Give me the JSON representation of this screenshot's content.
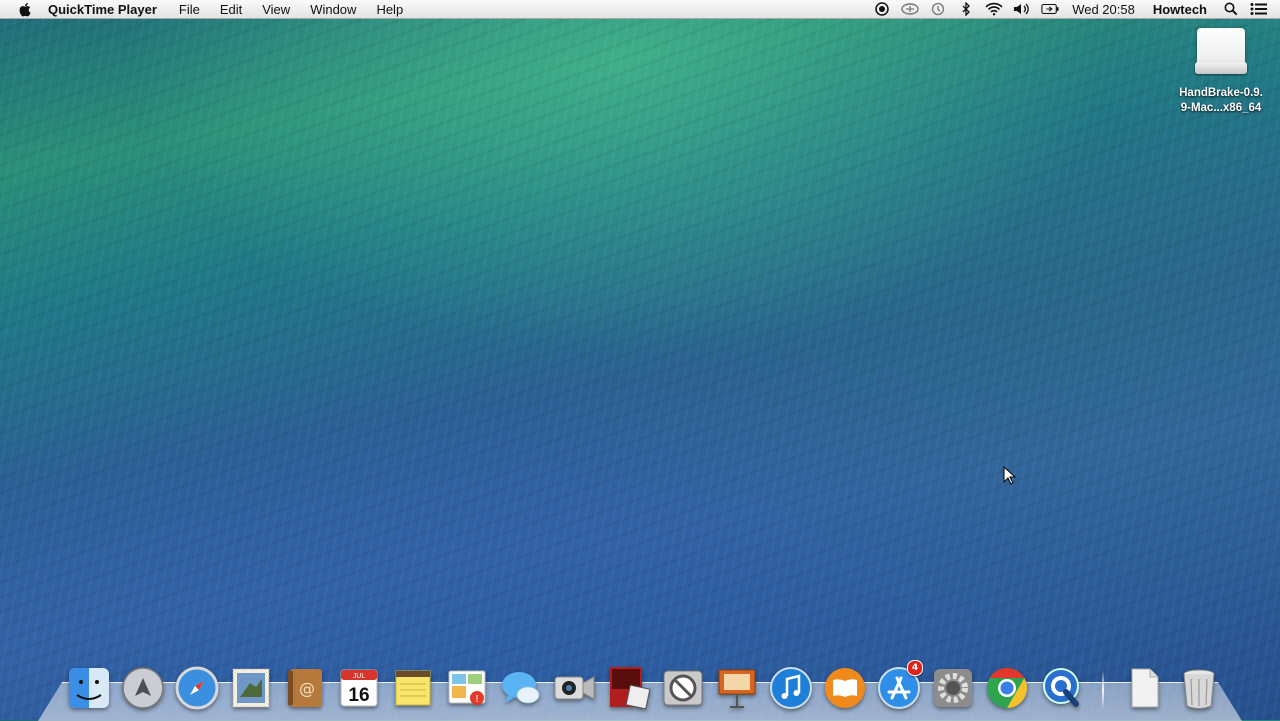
{
  "menubar": {
    "app_name": "QuickTime Player",
    "menus": [
      "File",
      "Edit",
      "View",
      "Window",
      "Help"
    ],
    "clock": "Wed 20:58",
    "user": "Howtech",
    "status_icons": [
      "screen-record-icon",
      "sync-icon",
      "time-machine-icon",
      "bluetooth-icon",
      "wifi-icon",
      "volume-icon",
      "battery-icon",
      "search-icon",
      "notification-center-icon"
    ]
  },
  "desktop": {
    "icons": [
      {
        "label_line1": "HandBrake-0.9.",
        "label_line2": "9-Mac...x86_64",
        "icon": "disk-image-icon"
      }
    ]
  },
  "dock": {
    "apps": [
      "finder",
      "launchpad",
      "safari",
      "mail",
      "contacts",
      "calendar",
      "notes",
      "reminders",
      "messages",
      "facetime",
      "photo-booth",
      "parental-controls",
      "keynote",
      "itunes",
      "ibooks",
      "app-store",
      "system-preferences",
      "chrome",
      "quicktime"
    ],
    "calendar_month": "JUL",
    "calendar_day": "16",
    "app_store_badge": "4",
    "right_items": [
      "documents-stack",
      "trash"
    ]
  },
  "colors": {
    "menubar_bg": "#ececec",
    "badge": "#e0221a",
    "wallpaper_top": "#2a8f78",
    "wallpaper_bottom": "#2c5a98"
  }
}
